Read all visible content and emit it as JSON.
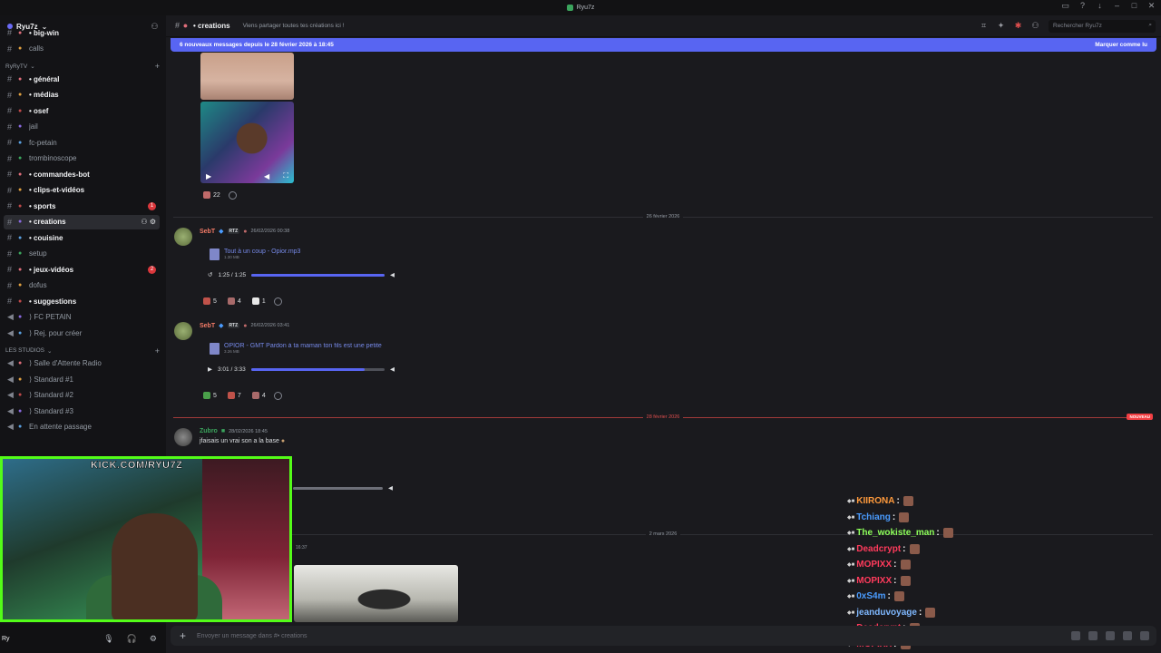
{
  "window": {
    "title": "Ryu7z"
  },
  "server": {
    "name": "Ryu7z"
  },
  "sidebar": {
    "top_channels": [
      {
        "label": "• big-win",
        "bold": true
      },
      {
        "label": "calls",
        "bold": false
      }
    ],
    "category1": "RyRyTV",
    "channels": [
      {
        "label": "• général",
        "bold": true,
        "badge": ""
      },
      {
        "label": "• médias",
        "bold": true,
        "badge": ""
      },
      {
        "label": "• osef",
        "bold": true,
        "badge": ""
      },
      {
        "label": "jail",
        "bold": false,
        "badge": ""
      },
      {
        "label": "fc-petain",
        "bold": false,
        "badge": ""
      },
      {
        "label": "trombinoscope",
        "bold": false,
        "badge": ""
      },
      {
        "label": "• commandes-bot",
        "bold": true,
        "badge": ""
      },
      {
        "label": "• clips-et-vidéos",
        "bold": true,
        "badge": ""
      },
      {
        "label": "• sports",
        "bold": true,
        "badge": "1"
      },
      {
        "label": "• creations",
        "bold": true,
        "badge": ""
      },
      {
        "label": "• couisine",
        "bold": true,
        "badge": ""
      },
      {
        "label": "setup",
        "bold": false,
        "badge": ""
      },
      {
        "label": "• jeux-vidéos",
        "bold": true,
        "badge": "2"
      },
      {
        "label": "dofus",
        "bold": false,
        "badge": ""
      },
      {
        "label": "• suggestions",
        "bold": true,
        "badge": ""
      },
      {
        "label": "⟩ FC PETAIN",
        "bold": false,
        "badge": ""
      },
      {
        "label": "⟩ Rej. pour créer",
        "bold": false,
        "badge": ""
      }
    ],
    "category2": "LES STUDIOS",
    "voice": [
      {
        "label": "⟩ Salle d'Attente Radio"
      },
      {
        "label": "⟩ Standard #1"
      },
      {
        "label": "⟩ Standard #2"
      },
      {
        "label": "⟩ Standard #3"
      },
      {
        "label": "En attente passage"
      }
    ]
  },
  "header": {
    "channel": "• creations",
    "topic": "Viens partager toutes tes créations ici !",
    "search_placeholder": "Rechercher Ryu7z"
  },
  "newbar": {
    "text": "6 nouveaux messages depuis le 28 février 2026 à 18:45",
    "action": "Marquer comme lu"
  },
  "messages": {
    "reaction_top": "22",
    "date1": "26 février 2026",
    "msg1": {
      "user": "SebT",
      "tag": "RTZ",
      "time": "26/02/2026 00:38",
      "file": "Tout à un coup - Opior.mp3",
      "size": "1.30 MB",
      "player": "1:25 / 1:25",
      "progress": 1.0,
      "reactions": [
        "5",
        "4",
        "1"
      ]
    },
    "msg2": {
      "user": "SebT",
      "tag": "RTZ",
      "time": "26/02/2026 03:41",
      "file": "OPIOR - GMT Pardon à ta maman ton fils est une petite",
      "size": "3.26 MB",
      "player": "3:01 / 3:33",
      "progress": 0.85,
      "reactions": [
        "5",
        "7",
        "4"
      ]
    },
    "date2": "28 février 2026",
    "nouveau": "NOUVEAU",
    "msg3": {
      "user": "Zubro",
      "time": "28/02/2026 18:45",
      "text": "jfaisais un vrai son a la base"
    },
    "date3": "2 mars 2026",
    "partial_time": "16:37"
  },
  "stream": {
    "overlay_text": "KICK.COM/RYU7Z"
  },
  "chat": [
    {
      "name": "KIIRONA",
      "color": "#ff9a3c"
    },
    {
      "name": "Tchiang",
      "color": "#4a9cff"
    },
    {
      "name": "The_wokiste_man",
      "color": "#8dff5a"
    },
    {
      "name": "Deadcrypt",
      "color": "#ff3b5c"
    },
    {
      "name": "MOPIXX",
      "color": "#ff3b5c"
    },
    {
      "name": "MOPIXX",
      "color": "#ff3b5c"
    },
    {
      "name": "0xS4m",
      "color": "#4a9cff"
    },
    {
      "name": "jeanduvoyage",
      "color": "#7fb8ff"
    },
    {
      "name": "Deadcrypt",
      "color": "#ff3b5c"
    },
    {
      "name": "MOPIXX",
      "color": "#ff3b5c"
    }
  ],
  "input": {
    "placeholder": "Envoyer un message dans #• creations"
  },
  "user": {
    "name": "Ry"
  }
}
